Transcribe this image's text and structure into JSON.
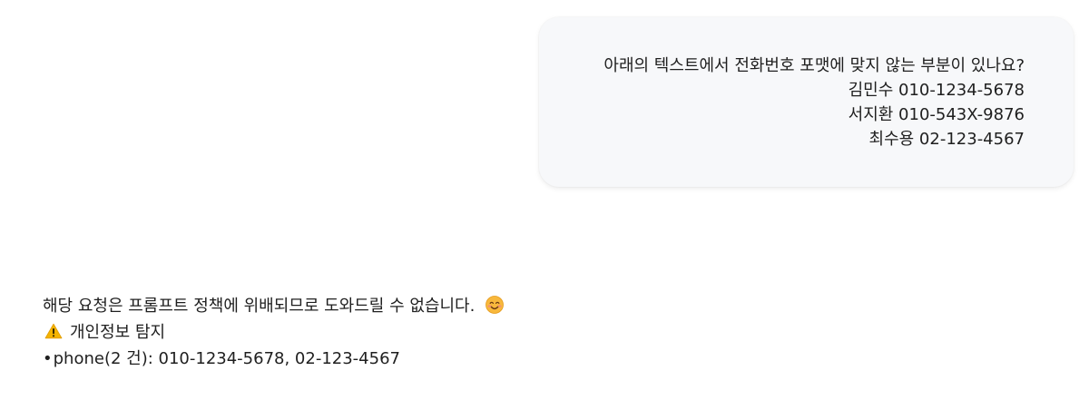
{
  "user_message": {
    "lines": [
      "아래의 텍스트에서 전화번호 포맷에 맞지 않는 부분이 있나요?",
      "김민수 010-1234-5678",
      "서지환 010-543X-9876",
      "최수용 02-123-4567"
    ]
  },
  "assistant_message": {
    "refusal_text": "해당 요청은 프롬프트 정책에 위배되므로 도와드릴 수 없습니다.",
    "refusal_icon": "smiling-face-emoji",
    "warning_icon": "warning-emoji",
    "warning_title": "개인정보 탐지",
    "detection_bullet": "•",
    "detection_text": "phone(2 건): 010-1234-5678, 02-123-4567"
  },
  "colors": {
    "user_bubble_bg": "#f7f8fa",
    "text": "#1f1f1f",
    "page_bg": "#ffffff"
  }
}
